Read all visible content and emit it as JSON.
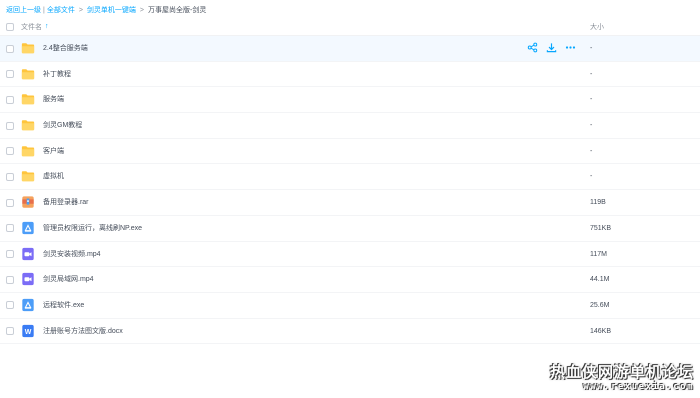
{
  "breadcrumb": {
    "back": "返回上一级",
    "root": "全部文件",
    "folder": "剑灵单机一键端",
    "current": "万事屋尚全版-剑灵"
  },
  "header": {
    "name_label": "文件名",
    "size_label": "大小"
  },
  "files": [
    {
      "name": "2.4整合服务端",
      "size": "-",
      "icon": "folder-icon"
    },
    {
      "name": "补丁教程",
      "size": "-",
      "icon": "folder-icon"
    },
    {
      "name": "服务端",
      "size": "-",
      "icon": "folder-icon"
    },
    {
      "name": "剑灵GM教程",
      "size": "-",
      "icon": "folder-icon"
    },
    {
      "name": "客户端",
      "size": "-",
      "icon": "folder-icon"
    },
    {
      "name": "虚拟机",
      "size": "-",
      "icon": "folder-icon"
    },
    {
      "name": "备用登录器.rar",
      "size": "119B",
      "icon": "archive-icon"
    },
    {
      "name": "管理员权限运行，离线刷NP.exe",
      "size": "751KB",
      "icon": "exe-icon"
    },
    {
      "name": "剑灵安装视频.mp4",
      "size": "117M",
      "icon": "video-icon"
    },
    {
      "name": "剑灵局域网.mp4",
      "size": "44.1M",
      "icon": "video-icon"
    },
    {
      "name": "远程软件.exe",
      "size": "25.6M",
      "icon": "exe-icon"
    },
    {
      "name": "注册账号方法图文版.docx",
      "size": "146KB",
      "icon": "word-icon"
    }
  ],
  "watermark": {
    "title": "热血侠网游单机论坛",
    "url": "www.rexuexia.com"
  },
  "colors": {
    "accent": "#06a7ff",
    "folder": "#ffc53d",
    "video": "#7b6cf6",
    "exe": "#4c9df8",
    "word": "#3a7cf4",
    "hover_row": "#f3f9ff"
  }
}
